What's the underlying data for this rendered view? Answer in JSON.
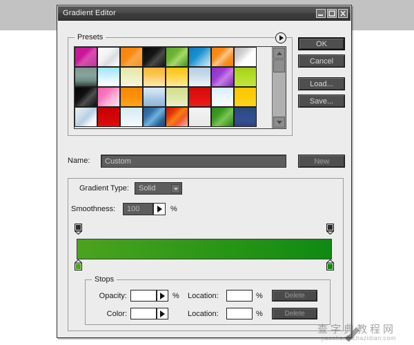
{
  "window": {
    "title": "Gradient Editor",
    "buttons": [
      {
        "name": "minimize-button",
        "glyph": "minimize"
      },
      {
        "name": "maximize-button",
        "glyph": "maximize"
      },
      {
        "name": "close-button",
        "glyph": "close"
      }
    ]
  },
  "presets": {
    "label": "Presets",
    "menu_icon": "presets-menu-icon",
    "scroll_up_icon": "scroll-up-arrow-icon",
    "scroll_down_icon": "scroll-down-arrow-icon",
    "swatches": [
      "linear-gradient(135deg,#c9179a 0%,#c9179a 38%,#d64fb0 55%,#c0369c 100%)",
      "linear-gradient(135deg,#ffffff 0%,#f2f2f2 40%,#d9dde0 62%,#ffffff 100%)",
      "linear-gradient(135deg,#f98009 0%,#fb8b12 42%,#f9a64a 60%,#f7921e 100%)",
      "linear-gradient(135deg,#0a0a0a 0%,#151515 40%,#4a4a4a 62%,#151515 100%)",
      "linear-gradient(135deg,#5ba52b 0%,#6fb733 38%,#a8d96a 58%,#3f8f1e 100%)",
      "linear-gradient(135deg,#0a7fc2 0%,#1b8fd0 40%,#88c8e8 72%,#cfe7f5 100%)",
      "linear-gradient(135deg,#f98009 0%,#fa8d17 34%,#fbc48d 52%,#f7921e 72%,#f07c06 100%)",
      "linear-gradient(135deg,#b9b9b9 0%,#d2d2d2 32%,#ffffff 58%,#ffffff 100%)",
      "linear-gradient(to bottom,#7d9790 0%,#88a39c 40%,#6f8e86 70%,#33413d 100%)",
      "linear-gradient(to bottom,#9fe6fb 0%,#b9eefd 30%,#e4f8fe 65%,#ffffff 100%)",
      "linear-gradient(to bottom,#e4e8a8 0%,#eaedb4 35%,#f2f2cd 70%,#f7f6e4 100%)",
      "linear-gradient(to bottom,#fbb739 0%,#fcc24a 32%,#fdd47b 62%,#fde7ae 100%)",
      "linear-gradient(to bottom,#fcc515 0%,#fccd2d 30%,#fdd95b 60%,#fde99e 100%)",
      "linear-gradient(to bottom,#b8cfe2 0%,#c5d8e8 35%,#dbe7f1 68%,#eef3f8 100%)",
      "linear-gradient(135deg,#8f2fcb 0%,#9c3dd4 36%,#c97ce8 58%,#7e27b6 100%)",
      "linear-gradient(to bottom,#a4cf18 0%,#addb22 30%,#b6e02e 60%,#bfe542 100%)",
      "linear-gradient(135deg,#050505 0%,#111111 38%,#4e4e4e 60%,#0c0c0c 100%)",
      "linear-gradient(135deg,#f763b0 0%,#f877bb 35%,#fbb3d7 62%,#fde3ef 100%)",
      "linear-gradient(to bottom,#fb8700 0%,#fc8f06 40%,#fd9a13 75%,#fda51f 100%)",
      "linear-gradient(to bottom,#d7e8f5 0%,#c6ddf0 28%,#a7c6e4 62%,#8fb4d8 100%)",
      "linear-gradient(to bottom,#d4dd8f 0%,#dae39c 35%,#e2e9b2 68%,#eaeec6 100%)",
      "linear-gradient(to bottom,#d60a0a 0%,#de0f0f 35%,#e51616 70%,#ee1e1e 100%)",
      "linear-gradient(to bottom,#d7eefb 0%,#e3f3fd 32%,#eff8fe 66%,#f8fcff 100%)",
      "linear-gradient(to bottom,#fdc600 0%,#fdca08 35%,#fdcf12 70%,#fed41d 100%)",
      "linear-gradient(135deg,#e7eef4 0%,#d2e0ec 30%,#b7cfe2 52%,#f3f8fc 78%,#ffffff 100%)",
      "linear-gradient(to bottom,#c70000 0%,#cf0303 35%,#d60808 70%,#de0e0e 100%)",
      "linear-gradient(to bottom,#d4ecf3 0%,#dff1f7 35%,#ebf6fa 70%,#f6fbfd 100%)",
      "linear-gradient(135deg,#2a5a8f 0%,#3673ad 30%,#6fb2dd 52%,#2d6699 78%,#1d4a78 100%)",
      "linear-gradient(135deg,#c9180b 0%,#e03a06 28%,#f77f10 48%,#ef5a2a 66%,#f4b6a5 100%)",
      "linear-gradient(to bottom,#f4f4f4 0%,#efefef 40%,#ebebeb 72%,#e8e8e8 100%)",
      "linear-gradient(135deg,#2f8a1a 0%,#3b9a22 32%,#79c653 58%,#2b7f17 100%)",
      "linear-gradient(to bottom,#2b4780 0%,#2f4e8c 35%,#334f8e 70%,#2c4478 100%)"
    ]
  },
  "actions": {
    "ok": "OK",
    "cancel": "Cancel",
    "load": "Load...",
    "save": "Save...",
    "new": "New"
  },
  "name_row": {
    "label": "Name:",
    "value": "Custom",
    "placeholder": "Custom"
  },
  "gradient": {
    "type_label": "Gradient Type:",
    "type_value": "Solid",
    "type_chevron_icon": "chevron-down-icon",
    "smoothness_label": "Smoothness:",
    "smoothness_value": "100",
    "smoothness_unit": "%",
    "smoothness_spinner_icon": "triangle-right-icon",
    "bar_start_color": "#4ca31e",
    "bar_end_color": "#0f8a12",
    "opacity_stops": [
      {
        "name": "opacity-stop-left",
        "position_pct": 0,
        "fill": "#2b2b2b"
      },
      {
        "name": "opacity-stop-right",
        "position_pct": 100,
        "fill": "#2b2b2b"
      }
    ],
    "color_stops": [
      {
        "name": "color-stop-left",
        "position_pct": 0,
        "fill": "#4ca31e"
      },
      {
        "name": "color-stop-right",
        "position_pct": 100,
        "fill": "#0f8a12"
      }
    ]
  },
  "stops": {
    "label": "Stops",
    "opacity_label": "Opacity:",
    "opacity_value": "",
    "opacity_unit": "%",
    "opacity_location_label": "Location:",
    "opacity_location_value": "",
    "opacity_location_unit": "%",
    "opacity_delete": "Delete",
    "color_label": "Color:",
    "color_value": "",
    "color_location_label": "Location:",
    "color_location_value": "",
    "color_location_unit": "%",
    "color_delete": "Delete",
    "spinner_icon": "triangle-right-icon"
  },
  "watermark": {
    "cn": "查字典教程网",
    "en": "jiaocheng.chazidian.com"
  }
}
